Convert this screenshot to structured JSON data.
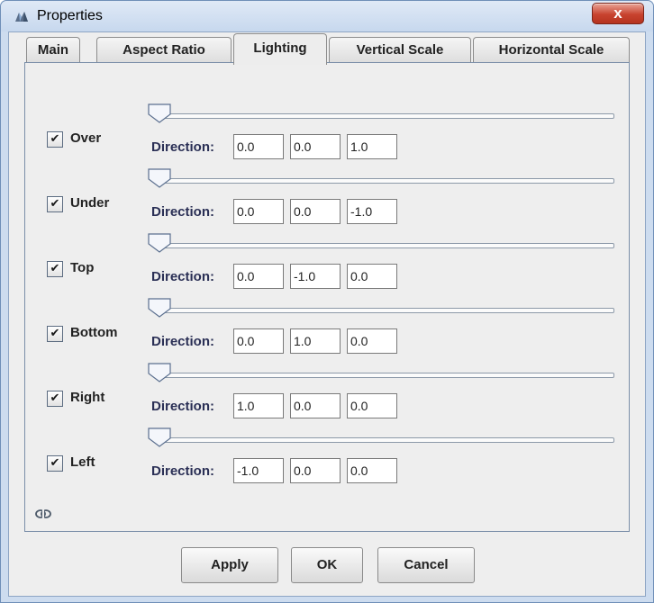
{
  "window": {
    "title": "Properties",
    "close_label": "x"
  },
  "tabs": [
    {
      "label": "Main"
    },
    {
      "label": "Aspect Ratio"
    },
    {
      "label": "Lighting",
      "active": true
    },
    {
      "label": "Vertical Scale"
    },
    {
      "label": "Horizontal Scale"
    }
  ],
  "lighting": {
    "direction_label": "Direction:",
    "rows": [
      {
        "label": "Over",
        "checked": true,
        "check_glyph": "✔",
        "direction": [
          "0.0",
          "0.0",
          "1.0"
        ],
        "slider_level": 0
      },
      {
        "label": "Under",
        "checked": true,
        "check_glyph": "✔",
        "direction": [
          "0.0",
          "0.0",
          "-1.0"
        ],
        "slider_level": 0
      },
      {
        "label": "Top",
        "checked": true,
        "check_glyph": "✔",
        "direction": [
          "0.0",
          "-1.0",
          "0.0"
        ],
        "slider_level": 0
      },
      {
        "label": "Bottom",
        "checked": true,
        "check_glyph": "✔",
        "direction": [
          "0.0",
          "1.0",
          "0.0"
        ],
        "slider_level": 0
      },
      {
        "label": "Right",
        "checked": true,
        "check_glyph": "✔",
        "direction": [
          "1.0",
          "0.0",
          "0.0"
        ],
        "slider_level": 0
      },
      {
        "label": "Left",
        "checked": true,
        "check_glyph": "✔",
        "direction": [
          "-1.0",
          "0.0",
          "0.0"
        ],
        "slider_level": 0
      }
    ],
    "link_icon": "link-icon"
  },
  "buttons": {
    "apply": "Apply",
    "ok": "OK",
    "cancel": "Cancel"
  },
  "colors": {
    "title_bar": "#c7d8ee",
    "close_button": "#c8432f",
    "panel_bg": "#eeeeee"
  }
}
